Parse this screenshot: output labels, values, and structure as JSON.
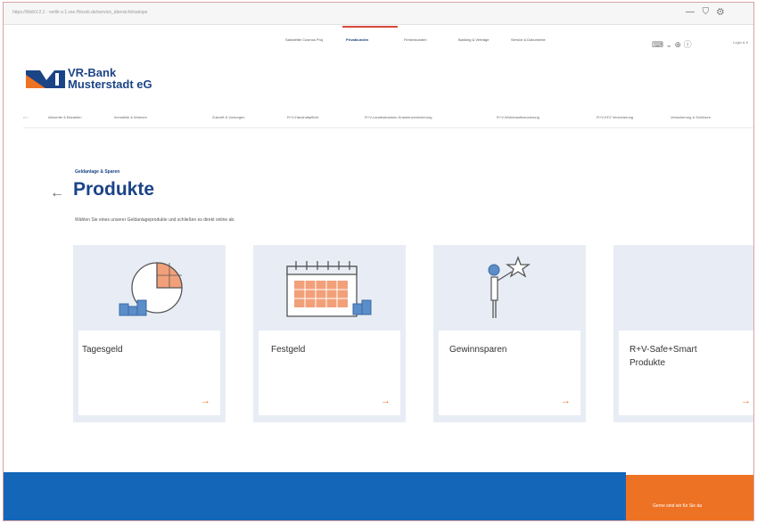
{
  "browser": {
    "url": "https://WebV.2.1 · vertik e.1.vse.Hinsvk.de/service_übersicht/sarispe",
    "controls": "— ⛉ ⚙"
  },
  "top_nav": [
    {
      "label": "Sakrdettle Cosmos Proj",
      "active": false
    },
    {
      "label": "Privatkunden",
      "active": true
    },
    {
      "label": "Firmenkunden",
      "active": false
    },
    {
      "label": "Banking & Verträge",
      "active": false
    },
    {
      "label": "Service & Dokumente",
      "active": false
    }
  ],
  "top_right": {
    "icons": "⌨ ⌄   ⊕   ⓘ",
    "login_label": "Login & K"
  },
  "logo": {
    "line1": "VR-Bank",
    "line2": "Musterstadt eG"
  },
  "category_nav": [
    "Absorrite & Bezahlen",
    "Immobilie & Wohnen",
    "Zukunft & Vorsorgen",
    "R+V-Haushaftpflicht",
    "R+V-Landeskranken-Krankenversicherung",
    "R+V-Wohnbaufinanzierung",
    "R+V-KFZ Versicherung",
    "Versicherung & Schützen"
  ],
  "page": {
    "breadcrumb": "Geldanlage & Sparen",
    "title": "Produkte",
    "back_icon": "←",
    "intro": "Wählen Sie eines unserer Geldanlageprodukte und schließen es direkt online ab."
  },
  "cards": [
    {
      "title": "Tagesgeld",
      "icon": "pie-chart-coins-icon",
      "arrow": "→"
    },
    {
      "title": "Festgeld",
      "icon": "calendar-coins-icon",
      "arrow": "→"
    },
    {
      "title": "Gewinnsparen",
      "icon": "person-star-icon",
      "arrow": "→"
    },
    {
      "title": "R+V-Safe+Smart Produkte",
      "icon": "",
      "arrow": "→"
    }
  ],
  "footer": {
    "cta_text": "Gerne sind wir für Sie da"
  },
  "colors": {
    "brand_blue": "#1b4487",
    "footer_blue": "#1466b8",
    "accent_orange": "#ee7224",
    "card_bg": "#e8edf5"
  }
}
